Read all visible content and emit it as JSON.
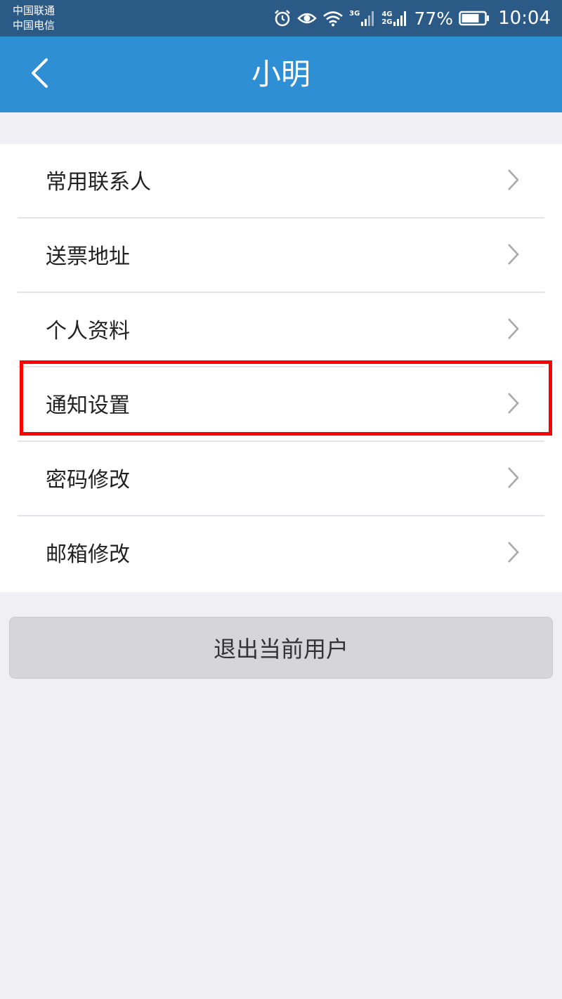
{
  "status_bar": {
    "carrier_1": "中国联通",
    "carrier_2": "中国电信",
    "net_1": "3G",
    "net_2a": "4G",
    "net_2b": "2G",
    "battery_percent": "77%",
    "battery_level": 0.77,
    "time": "10:04",
    "icons": [
      "alarm-icon",
      "eye-icon",
      "wifi-icon",
      "signal-icon",
      "signal-icon",
      "battery-icon"
    ]
  },
  "nav": {
    "title": "小明",
    "back_icon": "chevron-left-icon"
  },
  "menu": {
    "items": [
      {
        "label": "常用联系人"
      },
      {
        "label": "送票地址"
      },
      {
        "label": "个人资料"
      },
      {
        "label": "通知设置"
      },
      {
        "label": "密码修改"
      },
      {
        "label": "邮箱修改"
      }
    ],
    "highlighted_item": "通知设置"
  },
  "logout": {
    "label": "退出当前用户"
  },
  "colors": {
    "nav_bg": "#2e8fd5",
    "status_bg": "#2c5a87",
    "page_bg": "#efeff4",
    "highlight": "#ff0000"
  }
}
